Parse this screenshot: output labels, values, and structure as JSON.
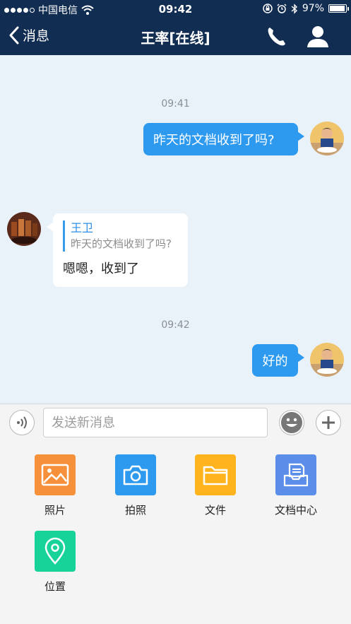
{
  "status_bar": {
    "carrier": "中国电信",
    "time": "09:42",
    "battery": "97%",
    "battery_level": 0.97
  },
  "nav": {
    "back_label": "消息",
    "title": "王率[在线]",
    "call_icon": "phone-icon",
    "profile_icon": "person-icon"
  },
  "chat": {
    "messages": [
      {
        "timestamp": "09:41",
        "direction": "outgoing",
        "text": "昨天的文档收到了吗?"
      },
      {
        "direction": "incoming",
        "quote_name": "王卫",
        "quote_text": "昨天的文档收到了吗?",
        "text": "嗯嗯，收到了"
      },
      {
        "timestamp": "09:42",
        "direction": "outgoing",
        "text": "好的"
      }
    ]
  },
  "input": {
    "placeholder": "发送新消息",
    "value": "",
    "voice_icon": "voice-icon",
    "emoji_icon": "emoji-icon",
    "add_icon": "plus-icon"
  },
  "attachments": [
    {
      "label": "照片",
      "icon": "image-icon",
      "color": "#f7903b"
    },
    {
      "label": "拍照",
      "icon": "camera-icon",
      "color": "#2d9af0"
    },
    {
      "label": "文件",
      "icon": "folder-icon",
      "color": "#ffb41e"
    },
    {
      "label": "文档中心",
      "icon": "document-tray-icon",
      "color": "#5b8ee8"
    },
    {
      "label": "位置",
      "icon": "location-icon",
      "color": "#17d39a"
    }
  ],
  "colors": {
    "nav_bg": "#112d52",
    "chat_bg": "#e9f1f9",
    "outgoing_bubble": "#2d9af0",
    "incoming_bubble": "#ffffff",
    "quote_accent": "#2d8ee6"
  }
}
